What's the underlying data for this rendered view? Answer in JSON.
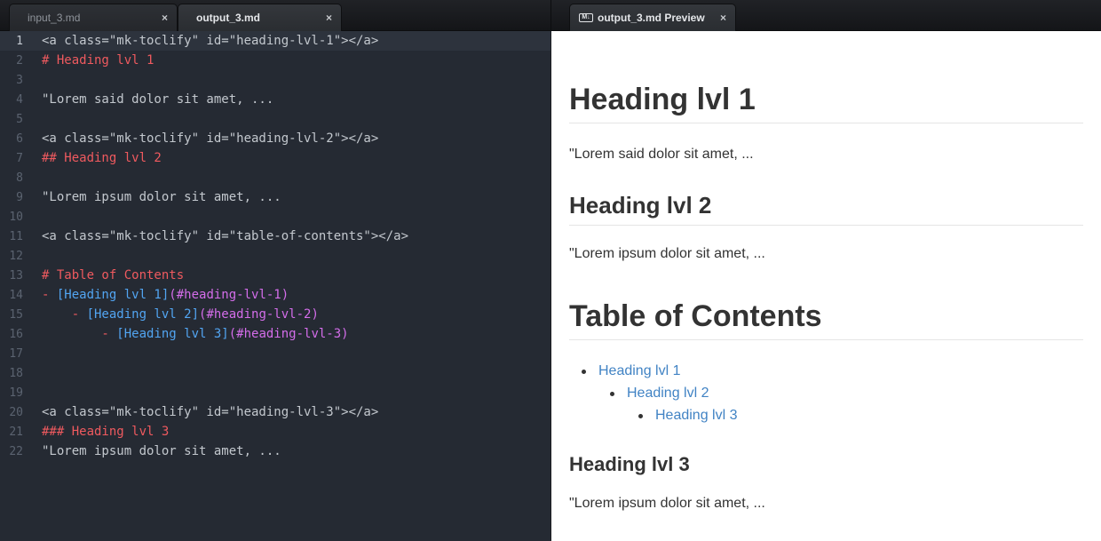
{
  "tabs_left": [
    {
      "label": "input_3.md",
      "close": "×",
      "active": false
    },
    {
      "label": "output_3.md",
      "close": "×",
      "active": true
    }
  ],
  "tabs_right": [
    {
      "label": "output_3.md Preview",
      "close": "×",
      "icon": "markdown-icon",
      "icon_text": "M↓",
      "active": true
    }
  ],
  "editor": {
    "lines": [
      {
        "num": "1",
        "text": "<a class=\"mk-toclify\" id=\"heading-lvl-1\"></a>"
      },
      {
        "num": "2",
        "text": "# Heading lvl 1"
      },
      {
        "num": "3",
        "text": ""
      },
      {
        "num": "4",
        "text": "\"Lorem said dolor sit amet, ..."
      },
      {
        "num": "5",
        "text": ""
      },
      {
        "num": "6",
        "text": "<a class=\"mk-toclify\" id=\"heading-lvl-2\"></a>"
      },
      {
        "num": "7",
        "text": "## Heading lvl 2"
      },
      {
        "num": "8",
        "text": ""
      },
      {
        "num": "9",
        "text": "\"Lorem ipsum dolor sit amet, ..."
      },
      {
        "num": "10",
        "text": ""
      },
      {
        "num": "11",
        "text": "<a class=\"mk-toclify\" id=\"table-of-contents\"></a>"
      },
      {
        "num": "12",
        "text": ""
      },
      {
        "num": "13",
        "text": "# Table of Contents"
      },
      {
        "num": "14",
        "dash": "- ",
        "link": "[Heading lvl 1]",
        "href": "(#heading-lvl-1)"
      },
      {
        "num": "15",
        "dash": "    - ",
        "link": "[Heading lvl 2]",
        "href": "(#heading-lvl-2)"
      },
      {
        "num": "16",
        "dash": "        - ",
        "link": "[Heading lvl 3]",
        "href": "(#heading-lvl-3)"
      },
      {
        "num": "17",
        "text": ""
      },
      {
        "num": "18",
        "text": ""
      },
      {
        "num": "19",
        "text": ""
      },
      {
        "num": "20",
        "text": "<a class=\"mk-toclify\" id=\"heading-lvl-3\"></a>"
      },
      {
        "num": "21",
        "text": "### Heading lvl 3"
      },
      {
        "num": "22",
        "text": "\"Lorem ipsum dolor sit amet, ..."
      }
    ]
  },
  "preview": {
    "h1_heading1": "Heading lvl 1",
    "p1": "\"Lorem said dolor sit amet, ...",
    "h2_heading2": "Heading lvl 2",
    "p2": "\"Lorem ipsum dolor sit amet, ...",
    "h1_toc": "Table of Contents",
    "toc": [
      {
        "label": "Heading lvl 1"
      },
      {
        "label": "Heading lvl 2"
      },
      {
        "label": "Heading lvl 3"
      }
    ],
    "h3_heading3": "Heading lvl 3",
    "p3": "\"Lorem ipsum dolor sit amet, ..."
  },
  "colors": {
    "editor_bg": "#252a33",
    "heading_red": "#ef5a5f",
    "link_blue": "#52a5f2",
    "url_purple": "#d46dea",
    "preview_link": "#4183c4"
  }
}
